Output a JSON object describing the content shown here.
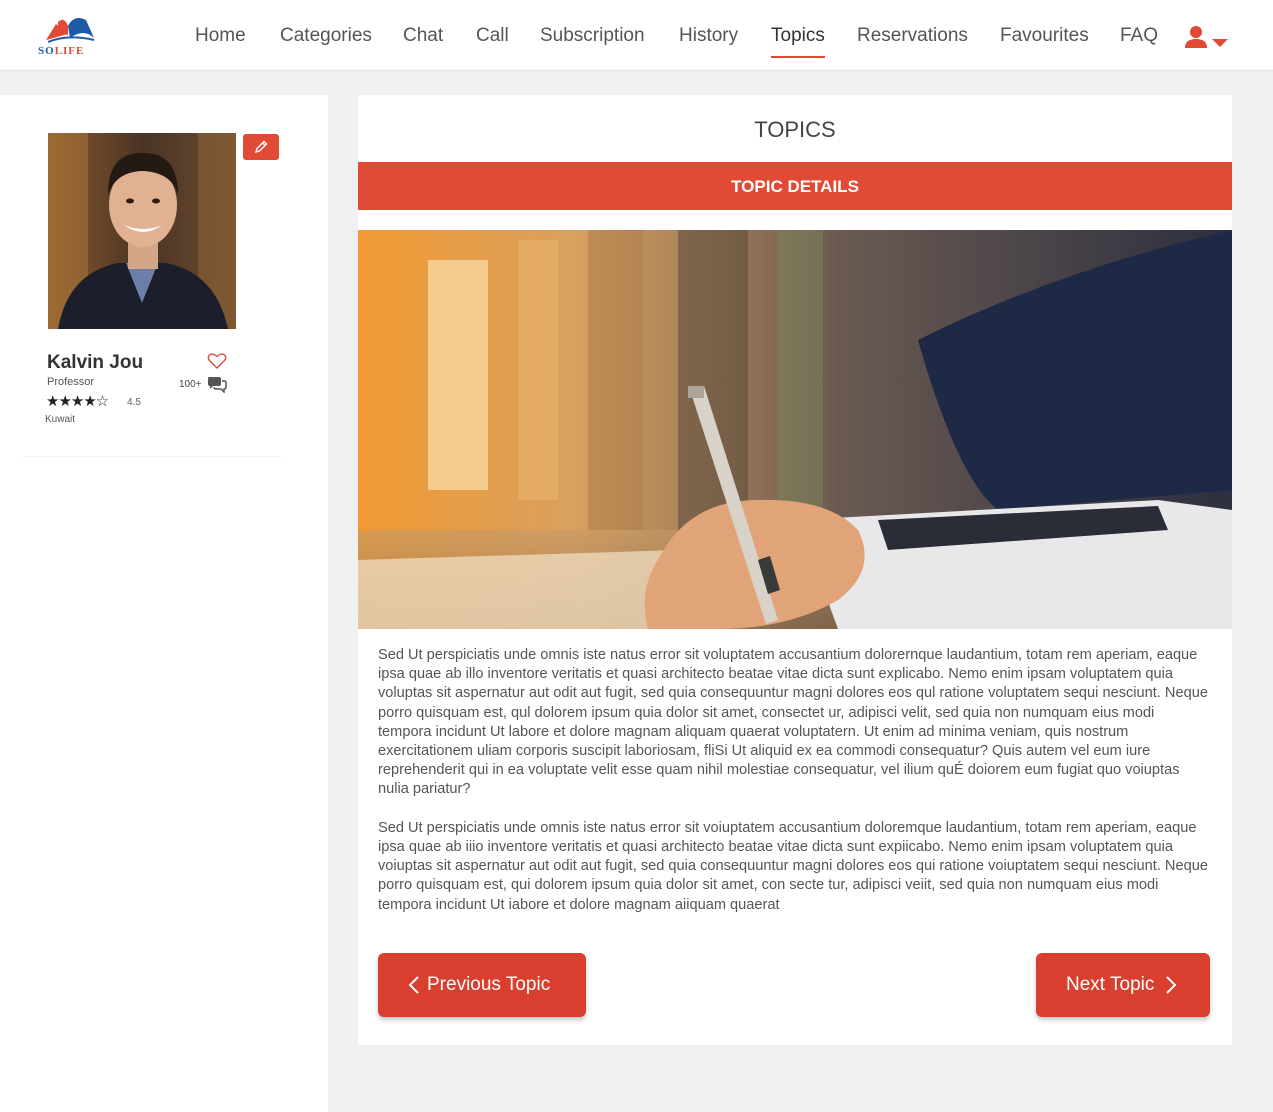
{
  "brand": {
    "logo_text_1": "SO",
    "logo_text_2": "LIFE",
    "colors": {
      "accent": "#e14a34",
      "blue": "#1f5aa6"
    }
  },
  "nav": {
    "items": [
      {
        "label": "Home"
      },
      {
        "label": "Categories"
      },
      {
        "label": "Chat"
      },
      {
        "label": "Call"
      },
      {
        "label": "Subscription"
      },
      {
        "label": "History"
      },
      {
        "label": "Topics",
        "active": true
      },
      {
        "label": "Reservations"
      },
      {
        "label": "Favourites"
      },
      {
        "label": "FAQ"
      }
    ],
    "user_icon": "user-icon",
    "dropdown_icon": "caret-down-icon"
  },
  "profile": {
    "name": "Kalvin Jou",
    "role": "Professor",
    "stars": "★★★★☆",
    "rating": "4.5",
    "location": "Kuwait",
    "chat_count": "100+",
    "icons": {
      "edit": "pencil-icon",
      "favourite": "heart-icon",
      "chat": "chat-icon"
    }
  },
  "main": {
    "title": "TOPICS",
    "section_title": "TOPIC DETAILS",
    "paragraphs": [
      "Sed Ut perspiciatis unde omnis iste natus error sit voluptatem accusantium dolorernque laudantium, totam rem aperiam, eaque ipsa quae ab illo inventore veritatis et quasi architecto beatae vitae dicta sunt explicabo. Nemo enim ipsam voluptatem quia voluptas sit aspernatur aut odit aut fugit, sed quia consequuntur magni dolores eos qul ratione voluptatem sequi nesciunt. Neque porro quisquam est, qul dolorem ipsum quia dolor sit amet, consectet ur, adipisci velit, sed quia non numquam eius modi tempora incidunt Ut labore et dolore magnam aliquam quaerat voluptatern. Ut enim ad minima veniam, quis nostrum exercitationem uliam corporis suscipit laboriosam, fliSi Ut aliquid ex ea commodi consequatur? Quis autem vel eum iure reprehenderit qui in ea voluptate velit esse quam nihil molestiae consequatur, vel ilium quÉ doiorem eum fugiat quo voiuptas nulia pariatur?",
      "Sed Ut perspiciatis unde omnis iste natus error sit voiuptatem accusantium doloremque laudantium, totam rem aperiam, eaque ipsa quae ab iiio inventore veritatis et quasi architecto beatae vitae dicta sunt expiicabo. Nemo enim ipsam voluptatem quia voiuptas sit aspernatur aut odit aut fugit, sed quia consequuntur magni dolores eos qui ratione voiuptatem sequi nesciunt. Neque porro quisquam est, qui dolorem ipsum quia dolor sit amet, con secte tur, adipisci veiit, sed quia non numquam eius modi tempora incidunt Ut iabore et dolore magnam aiiquam quaerat"
    ],
    "prev_label": "Previous Topic",
    "next_label": "Next Topic"
  }
}
